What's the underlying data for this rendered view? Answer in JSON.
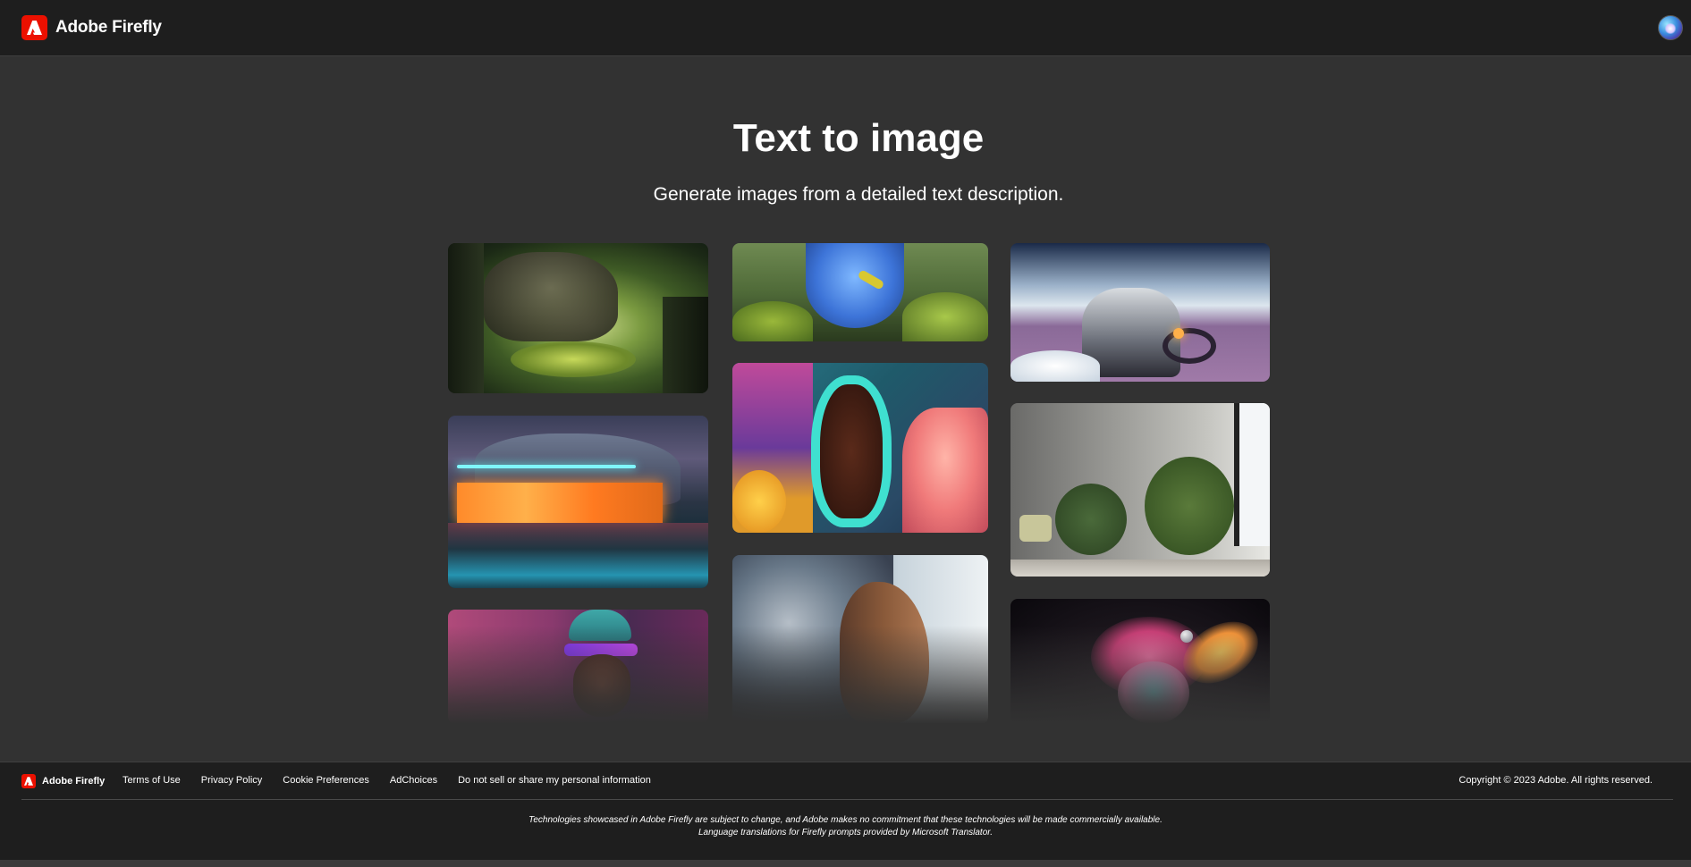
{
  "header": {
    "brand_name": "Adobe Firefly",
    "logo_icon": "adobe-logo-icon",
    "avatar_icon": "user-avatar"
  },
  "hero": {
    "title": "Text to image",
    "subtitle": "Generate images from a detailed text description."
  },
  "gallery": {
    "images": [
      {
        "subject": "enchanted forest tree house"
      },
      {
        "subject": "fluffy blue creature on moss"
      },
      {
        "subject": "astronaut on motorcycle on moon"
      },
      {
        "subject": "neon-lit buildings by a lake at night"
      },
      {
        "subject": "coral seahorse underwater"
      },
      {
        "subject": "interior room with plants"
      },
      {
        "subject": "person in beanie with sunglasses"
      },
      {
        "subject": "woman profile with cloud double exposure"
      },
      {
        "subject": "colorful powder explosion planets"
      }
    ]
  },
  "footer": {
    "brand_name": "Adobe Firefly",
    "links": [
      "Terms of Use",
      "Privacy Policy",
      "Cookie Preferences",
      "AdChoices",
      "Do not sell or share my personal information"
    ],
    "copyright": "Copyright © 2023 Adobe. All rights reserved.",
    "disclaimer_line1": "Technologies showcased in Adobe Firefly are subject to change, and Adobe makes no commitment that these technologies will be made commercially available.",
    "disclaimer_line2": "Language translations for Firefly prompts provided by Microsoft Translator."
  },
  "colors": {
    "brand_red": "#eb1000",
    "header_bg": "#1e1e1e",
    "page_bg": "#323232"
  }
}
